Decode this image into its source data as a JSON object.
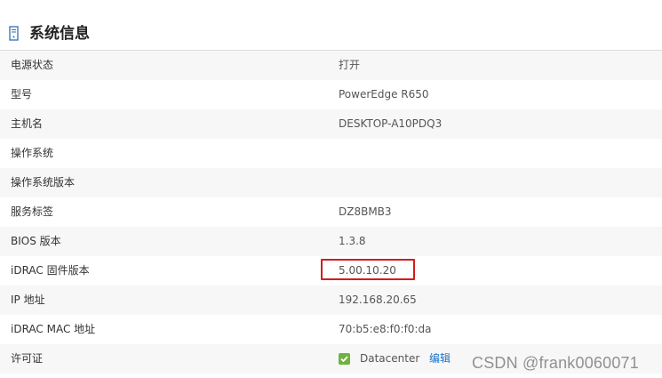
{
  "section": {
    "title": "系统信息",
    "icon": "server-icon"
  },
  "rows": [
    {
      "label": "电源状态",
      "value": "打开"
    },
    {
      "label": "型号",
      "value": "PowerEdge R650"
    },
    {
      "label": "主机名",
      "value": "DESKTOP-A10PDQ3"
    },
    {
      "label": "操作系统",
      "value": ""
    },
    {
      "label": "操作系统版本",
      "value": ""
    },
    {
      "label": "服务标签",
      "value": "DZ8BMB3"
    },
    {
      "label": "BIOS 版本",
      "value": "1.3.8"
    },
    {
      "label": "iDRAC 固件版本",
      "value": "5.00.10.20"
    },
    {
      "label": "IP 地址",
      "value": "192.168.20.65"
    },
    {
      "label": "iDRAC MAC 地址",
      "value": "70:b5:e8:f0:f0:da"
    }
  ],
  "license": {
    "label": "许可证",
    "checked": true,
    "value": "Datacenter",
    "edit_label": "编辑"
  },
  "watermark": "CSDN @frank0060071",
  "colors": {
    "highlight": "#d41c1c",
    "link": "#1a73c8",
    "check": "#6fb23f"
  }
}
